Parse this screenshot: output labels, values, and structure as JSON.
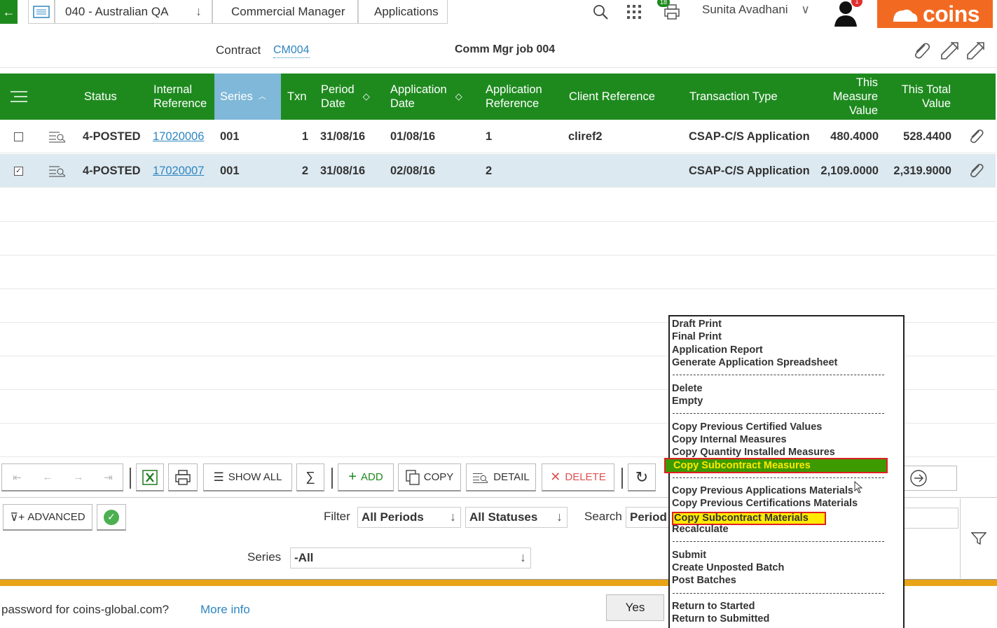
{
  "breadcrumbs": {
    "company": "040 - Australian QA",
    "module": "Commercial Manager",
    "page": "Applications"
  },
  "topbar": {
    "user": "Sunita Avadhani",
    "print_badge": "18",
    "notif_badge": "1",
    "logo": "coins"
  },
  "contract": {
    "label": "Contract",
    "code": "CM004",
    "name": "Comm Mgr job 004"
  },
  "grid": {
    "headers": {
      "status": "Status",
      "internal_ref_1": "Internal",
      "internal_ref_2": "Reference",
      "series": "Series",
      "txn": "Txn",
      "period_1": "Period",
      "period_2": "Date",
      "app_date_1": "Application",
      "app_date_2": "Date",
      "app_ref_1": "Application",
      "app_ref_2": "Reference",
      "client_ref": "Client Reference",
      "trans_type": "Transaction Type",
      "measure_1": "This",
      "measure_2": "Measure",
      "measure_3": "Value",
      "total_1": "This Total",
      "total_2": "Value"
    },
    "rows": [
      {
        "checked": false,
        "status": "4-POSTED",
        "internal_ref": "17020006",
        "series": "001",
        "txn": "1",
        "period_date": "31/08/16",
        "app_date": "01/08/16",
        "app_ref": "1",
        "client_ref": "cliref2",
        "trans_type": "CSAP-C/S Application",
        "measure_value": "480.4000",
        "total_value": "528.4400"
      },
      {
        "checked": true,
        "status": "4-POSTED",
        "internal_ref": "17020007",
        "series": "001",
        "txn": "2",
        "period_date": "31/08/16",
        "app_date": "02/08/16",
        "app_ref": "2",
        "client_ref": "",
        "trans_type": "CSAP-C/S Application",
        "measure_value": "2,109.0000",
        "total_value": "2,319.9000"
      }
    ]
  },
  "toolbar": {
    "show_all": "SHOW ALL",
    "add": "ADD",
    "copy": "COPY",
    "detail": "DETAIL",
    "delete": "DELETE"
  },
  "filters": {
    "advanced": "ADVANCED",
    "filter_label": "Filter",
    "period_value": "All Periods",
    "status_value": "All Statuses",
    "search_label": "Search",
    "search_by": "Period",
    "series_label": "Series",
    "series_value": "-All"
  },
  "password_bar": {
    "text": "password for coins-global.com?",
    "more_info": "More info",
    "yes": "Yes"
  },
  "context_menu": {
    "draft_print": "Draft Print",
    "final_print": "Final Print",
    "app_report": "Application Report",
    "gen_spreadsheet": "Generate Application Spreadsheet",
    "delete": "Delete",
    "empty": "Empty",
    "copy_prev_cert": "Copy Previous Certified Values",
    "copy_internal": "Copy Internal Measures",
    "copy_qty": "Copy Quantity Installed Measures",
    "copy_sub_measures": "Copy Subcontract Measures",
    "copy_prev_app_mat": "Copy Previous Applications Materials",
    "copy_prev_cert_mat": "Copy Previous Certifications Materials",
    "copy_sub_mat": "Copy Subcontract Materials",
    "recalculate": "Recalculate",
    "submit": "Submit",
    "create_batch": "Create Unposted Batch",
    "post_batches": "Post Batches",
    "return_started": "Return to Started",
    "return_submitted": "Return to Submitted"
  },
  "colors": {
    "header_green": "#1e8a1e",
    "logo_orange": "#f26a21",
    "link_blue": "#2e86c1",
    "highlight_green": "#3d9a00",
    "highlight_yellow": "#ffea00"
  }
}
